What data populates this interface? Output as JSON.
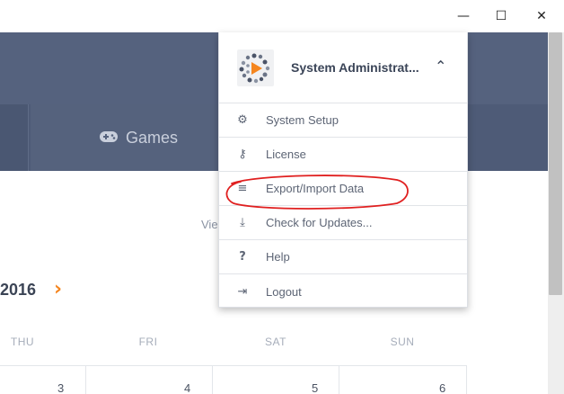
{
  "window": {
    "minimize_icon": "—",
    "maximize_icon": "☐",
    "close_icon": "✕"
  },
  "nav": {
    "games_label": "Games",
    "games_icon": "gamepad-icon"
  },
  "main": {
    "view_text": "Vie",
    "year": "2016",
    "next_icon": "›",
    "days": [
      "THU",
      "FRI",
      "SAT",
      "SUN"
    ],
    "dates": [
      "3",
      "4",
      "5",
      "6"
    ]
  },
  "dropdown": {
    "user_name": "System Administrat...",
    "chevron": "⌃",
    "items": [
      {
        "label": "System Setup",
        "icon": "⚙"
      },
      {
        "label": "License",
        "icon": "⚷"
      },
      {
        "label": "Export/Import Data",
        "icon": "≡"
      },
      {
        "label": "Check for Updates...",
        "icon": "⤓"
      },
      {
        "label": "Help",
        "icon": "?"
      },
      {
        "label": "Logout",
        "icon": "⇥"
      }
    ]
  },
  "colors": {
    "header": "#55627e",
    "navbar": "#4e5b77",
    "accent": "#f5861f",
    "annotation": "#e02020"
  }
}
